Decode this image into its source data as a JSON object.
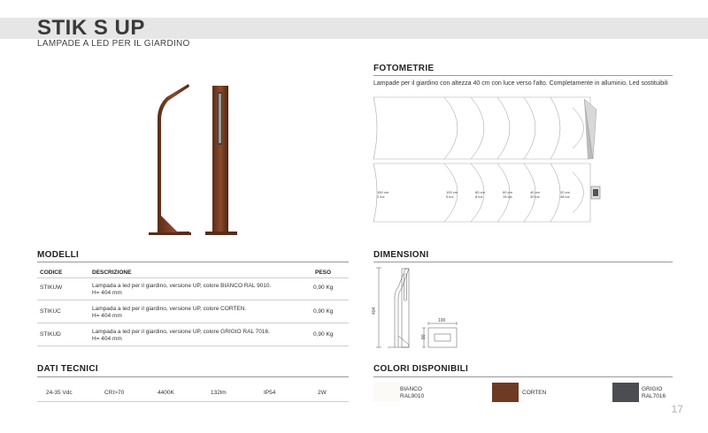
{
  "header": {
    "title": "STIK S UP",
    "subtitle": "LAMPADE A LED PER IL GIARDINO"
  },
  "fotometrie": {
    "title": "FOTOMETRIE",
    "description": "Lampade per il giardino con altezza 40 cm con luce verso l'alto. Completamente in alluminio. Led sostituibili",
    "labels": [
      {
        "cm": "150 cm",
        "lux": "2 lux"
      },
      {
        "cm": "100 cm",
        "lux": "5 lux"
      },
      {
        "cm": "80 cm",
        "lux": "8 lux"
      },
      {
        "cm": "60 cm",
        "lux": "15 lux"
      },
      {
        "cm": "40 cm",
        "lux": "30 lux"
      },
      {
        "cm": "20 cm",
        "lux": "48 lux"
      }
    ]
  },
  "modelli": {
    "title": "MODELLI",
    "headers": {
      "code": "CODICE",
      "desc": "DESCRIZIONE",
      "weight": "PESO"
    },
    "rows": [
      {
        "code": "STIKUW",
        "desc1": "Lampada a led per il giardino, versione UP, colore BIANCO RAL 9010.",
        "desc2": "H= 404 mm",
        "weight": "0,90 Kg"
      },
      {
        "code": "STIKUC",
        "desc1": "Lampada a led per il giardino, versione UP, colore CORTEN.",
        "desc2": "H= 404 mm",
        "weight": "0,90 Kg"
      },
      {
        "code": "STIKUD",
        "desc1": "Lampada a led per il giardino, versione UP, colore GRIGIO RAL 7016.",
        "desc2": "H= 404 mm",
        "weight": "0,90 Kg"
      }
    ]
  },
  "dimensioni": {
    "title": "DIMENSIONI",
    "height": "404",
    "width": "100",
    "depth": "80"
  },
  "dati": {
    "title": "DATI TECNICI",
    "values": [
      "24-35 Vdc",
      "CRI>70",
      "4400K",
      "132lm",
      "IP54",
      "2W"
    ]
  },
  "colori": {
    "title": "COLORI DISPONIBILI",
    "items": [
      {
        "line1": "BIANCO",
        "line2": "RAL9010",
        "color": "#fbfaf6"
      },
      {
        "line1": "CORTEN",
        "line2": "",
        "color": "#6e3a24"
      },
      {
        "line1": "GRIGIO",
        "line2": "RAL7016",
        "color": "#4b4d50"
      }
    ]
  },
  "page_number": "17"
}
